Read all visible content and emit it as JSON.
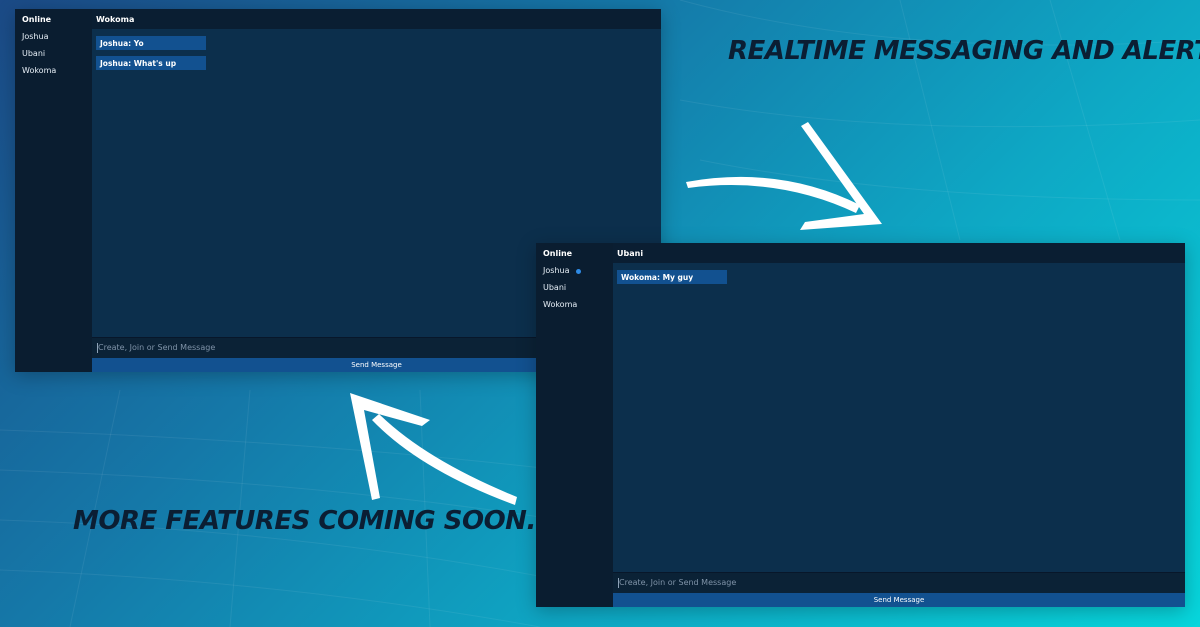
{
  "promo": {
    "headline": "REALTIME MESSAGING AND ALERTS",
    "footer": "MORE FEATURES COMING SOON."
  },
  "window_left": {
    "sidebar_title": "Online",
    "users": [
      "Joshua",
      "Ubani",
      "Wokoma"
    ],
    "header_title": "Wokoma",
    "messages": [
      "Joshua: Yo",
      "Joshua: What's up"
    ],
    "input_placeholder": "Create, Join or Send Message",
    "send_label": "Send Message"
  },
  "window_right": {
    "sidebar_title": "Online",
    "users": [
      "Joshua",
      "Ubani",
      "Wokoma"
    ],
    "header_title": "Ubani",
    "messages": [
      "Wokoma: My guy"
    ],
    "input_placeholder": "Create, Join or Send Message",
    "send_label": "Send Message"
  },
  "colors": {
    "accent": "#125190",
    "sidebar_bg": "#0a1d30",
    "chat_bg": "#0c2f4c",
    "online_dot": "#2e8be6"
  }
}
